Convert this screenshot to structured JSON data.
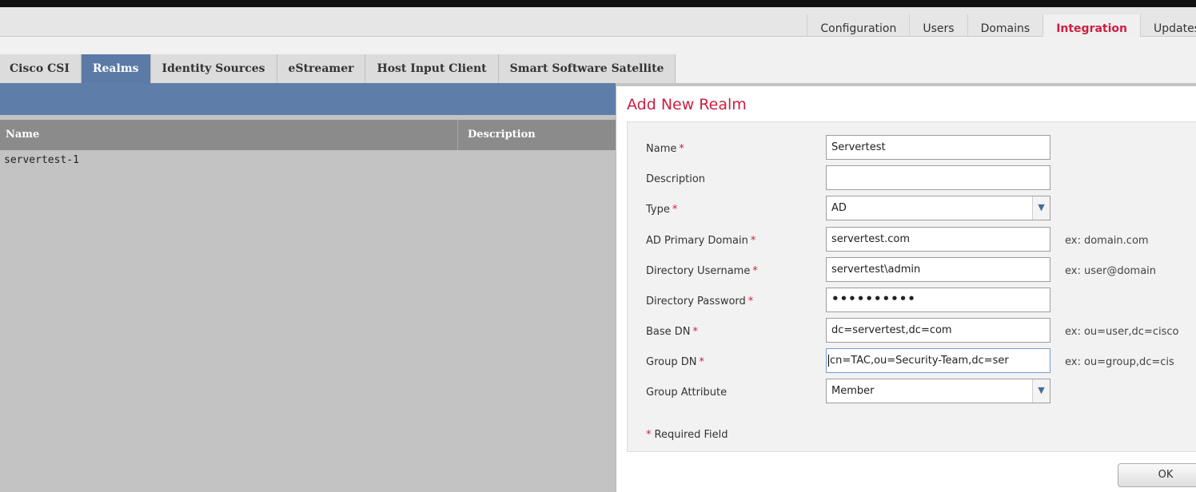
{
  "top_nav": {
    "items": [
      {
        "label": "Configuration",
        "active": false
      },
      {
        "label": "Users",
        "active": false
      },
      {
        "label": "Domains",
        "active": false
      },
      {
        "label": "Integration",
        "active": true
      },
      {
        "label": "Updates",
        "active": false
      }
    ]
  },
  "tabs": {
    "items": [
      {
        "label": "Cisco CSI",
        "active": false
      },
      {
        "label": "Realms",
        "active": true
      },
      {
        "label": "Identity Sources",
        "active": false
      },
      {
        "label": "eStreamer",
        "active": false
      },
      {
        "label": "Host Input Client",
        "active": false
      },
      {
        "label": "Smart Software Satellite",
        "active": false
      }
    ]
  },
  "realm_list": {
    "columns": [
      "Name",
      "Description"
    ],
    "rows": [
      {
        "name": "servertest-1",
        "description": ""
      }
    ]
  },
  "dialog": {
    "title": "Add New Realm",
    "fields": {
      "name": {
        "label": "Name",
        "value": "Servertest",
        "required": "*"
      },
      "description": {
        "label": "Description",
        "value": ""
      },
      "type": {
        "label": "Type",
        "value": "AD",
        "required": "*"
      },
      "ad_primary_domain": {
        "label": "AD Primary Domain",
        "value": "servertest.com",
        "required": "*",
        "hint": "ex: domain.com"
      },
      "directory_username": {
        "label": "Directory Username",
        "value": "servertest\\admin",
        "required": "*",
        "hint": "ex: user@domain"
      },
      "directory_password": {
        "label": "Directory Password",
        "value": "••••••••••",
        "required": "*"
      },
      "base_dn": {
        "label": "Base DN",
        "value": "dc=servertest,dc=com",
        "required": "*",
        "hint": "ex: ou=user,dc=cisco"
      },
      "group_dn": {
        "label": "Group DN",
        "value": "cn=TAC,ou=Security-Team,dc=ser",
        "required": "*",
        "hint": "ex: ou=group,dc=cis"
      },
      "group_attribute": {
        "label": "Group Attribute",
        "value": "Member"
      }
    },
    "required_note": "Required Field",
    "required_mark": "*",
    "ok_label": "OK"
  },
  "icons": {
    "dropdown_arrow": "chevron-down-icon",
    "dropdown_glyph": "▼"
  },
  "colors": {
    "accent_red": "#cc1f42",
    "tab_active": "#5b7aa5",
    "header_bar": "#5e7ea9"
  }
}
